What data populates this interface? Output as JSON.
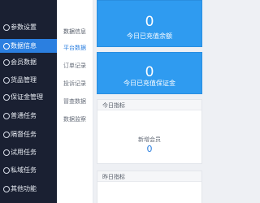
{
  "colors": {
    "sidebar_bg": "#1a2032",
    "accent": "#2b7fe0",
    "stat_card_bg": "#2f9bf0",
    "content_bg": "#eef0f4"
  },
  "sidebar": {
    "items": [
      {
        "label": "参数设置",
        "icon": "settings-icon",
        "active": false
      },
      {
        "label": "数据信息",
        "icon": "data-icon",
        "active": true
      },
      {
        "label": "会员数据",
        "icon": "member-icon",
        "active": false
      },
      {
        "label": "货品管理",
        "icon": "goods-icon",
        "active": false
      },
      {
        "label": "保证金管理",
        "icon": "deposit-icon",
        "active": false
      },
      {
        "label": "普通任务",
        "icon": "task-icon",
        "active": false
      },
      {
        "label": "隔督任务",
        "icon": "supervise-icon",
        "active": false
      },
      {
        "label": "试用任务",
        "icon": "trial-icon",
        "active": false
      },
      {
        "label": "私域任务",
        "icon": "private-icon",
        "active": false
      },
      {
        "label": "其他功能",
        "icon": "other-icon",
        "active": false
      }
    ]
  },
  "subnav": {
    "title": "数据信息",
    "items": [
      {
        "label": "平台数据",
        "active": true
      },
      {
        "label": "订单记录",
        "active": false
      },
      {
        "label": "投诉记录",
        "active": false
      },
      {
        "label": "冒查数据",
        "active": false
      },
      {
        "label": "数据监察",
        "active": false
      }
    ]
  },
  "main": {
    "cards": [
      {
        "value": "0",
        "label": "今日已充值余额"
      },
      {
        "value": "0",
        "label": "今日已充值保证金"
      }
    ],
    "today_panel": {
      "title": "今日指标",
      "metric_label": "新增会员",
      "metric_value": "0"
    },
    "yesterday_panel": {
      "title": "昨日指标"
    }
  }
}
